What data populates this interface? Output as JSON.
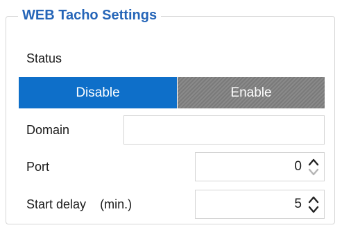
{
  "group": {
    "title": "WEB Tacho Settings"
  },
  "status": {
    "label": "Status",
    "options": [
      "Disable",
      "Enable"
    ],
    "selected": "Disable"
  },
  "domain": {
    "label": "Domain",
    "value": ""
  },
  "port": {
    "label": "Port",
    "value": "0"
  },
  "start_delay": {
    "label": "Start delay",
    "unit": "(min.)",
    "value": "5"
  },
  "colors": {
    "title": "#2565b8",
    "selected_segment": "#0e6fc9",
    "unselected_segment": "#808080",
    "border": "#d4d4d4"
  },
  "icons": {
    "spinner_up": "chevron-up-icon",
    "spinner_down": "chevron-down-icon"
  }
}
